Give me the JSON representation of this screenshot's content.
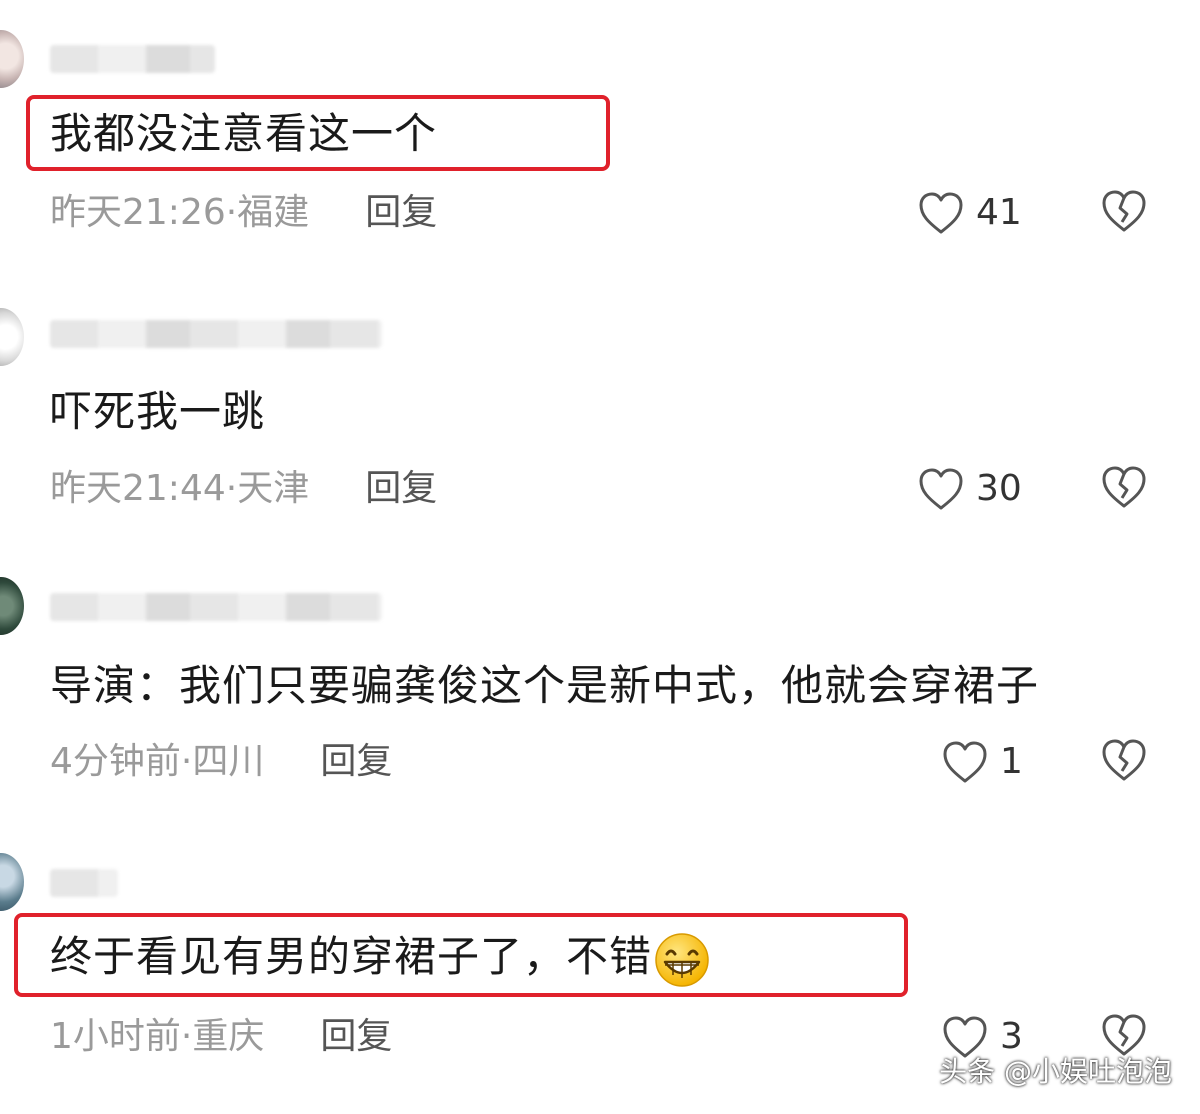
{
  "comments": [
    {
      "text": "我都没注意看这一个",
      "time": "昨天21:26",
      "location": "福建",
      "reply_label": "回复",
      "likes": "41",
      "highlighted": true
    },
    {
      "text": "吓死我一跳",
      "time": "昨天21:44",
      "location": "天津",
      "reply_label": "回复",
      "likes": "30",
      "highlighted": false
    },
    {
      "text": "导演：我们只要骗龚俊这个是新中式，他就会穿裙子",
      "time": "4分钟前",
      "location": "四川",
      "reply_label": "回复",
      "likes": "1",
      "highlighted": false
    },
    {
      "text": "终于看见有男的穿裙子了，不错",
      "time": "1小时前",
      "location": "重庆",
      "reply_label": "回复",
      "likes": "3",
      "highlighted": true,
      "emoji": "grinning-face-icon"
    }
  ],
  "meta_separator": " · ",
  "watermark": "头条 @小娱吐泡泡",
  "colors": {
    "highlight_border": "#e0212b",
    "meta_text": "#9a9a9a",
    "comment_text": "#1a1a1a"
  }
}
